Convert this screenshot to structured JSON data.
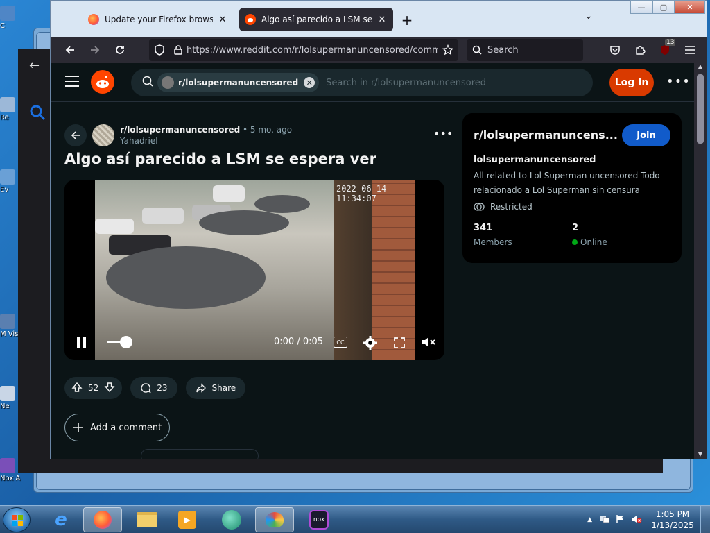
{
  "desktop": {
    "icons": [
      {
        "label": "C",
        "color": "#4f86c6"
      },
      {
        "label": "Re",
        "color": "#9cb8d8"
      },
      {
        "label": "Ev",
        "color": "#6aa0d6"
      },
      {
        "label": "M Vis",
        "color": "#5a7fb0"
      },
      {
        "label": "Ne",
        "color": "#c9d6e6"
      },
      {
        "label": "Nox A",
        "color": "#7a4fb8"
      }
    ]
  },
  "browser": {
    "tabs": [
      {
        "title": "Update your Firefox browser",
        "icon": "firefox-icon",
        "close": "✕"
      },
      {
        "title": "Algo así parecido a LSM se espera ver",
        "icon": "reddit-icon",
        "close": "✕"
      }
    ],
    "new_tab": "+",
    "url": "https://www.reddit.com/r/lolsupermanuncensored/comments/",
    "search_placeholder": "Search",
    "extensions_badge": "13"
  },
  "reddit": {
    "search_chip": "r/lolsupermanuncensored",
    "search_placeholder": "Search in r/lolsupermanuncensored",
    "login_label": "Log In",
    "more": "•••",
    "post": {
      "subreddit": "r/lolsupermanuncensored",
      "age": "• 5 mo. ago",
      "author": "Yahadriel",
      "title": "Algo así parecido a LSM se espera ver",
      "video": {
        "timestamp": "2022-06-14 11:34:07",
        "time": "0:00 / 0:05",
        "cc": "CC",
        "volume": 0.35
      },
      "votes": "52",
      "comments": "23",
      "share_label": "Share",
      "add_comment_label": "Add a comment"
    },
    "sidebar": {
      "title": "r/lolsupermanuncens...",
      "join_label": "Join",
      "name": "lolsupermanuncensored",
      "description": "All related to Lol Superman uncensored Todo relacionado a Lol Superman sin censura",
      "restricted_label": "Restricted",
      "members_count": "341",
      "members_label": "Members",
      "online_count": "2",
      "online_label": "Online"
    }
  },
  "taskbar": {
    "time": "1:05 PM",
    "date": "1/13/2025",
    "apps": [
      "ie-icon",
      "firefox-icon",
      "explorer-icon",
      "media-icon",
      "browser-icon",
      "paint-icon",
      "nox-icon"
    ]
  },
  "colors": {
    "reddit_orange": "#ff4500",
    "login_bg": "#d93a00",
    "join_bg": "#115bca",
    "online_green": "#01a816",
    "page_bg": "#0b1416"
  }
}
